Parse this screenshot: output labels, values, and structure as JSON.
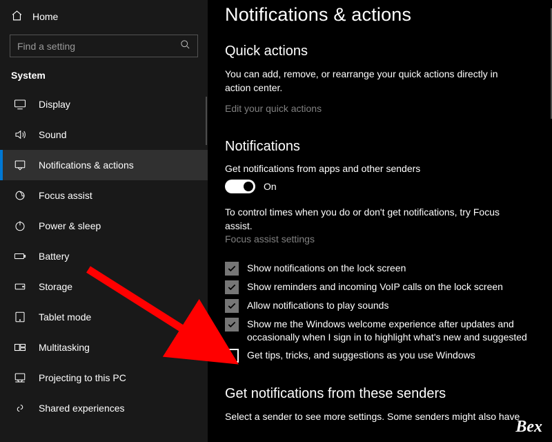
{
  "sidebar": {
    "home_label": "Home",
    "search_placeholder": "Find a setting",
    "group_label": "System",
    "items": [
      {
        "icon": "display-icon",
        "label": "Display"
      },
      {
        "icon": "sound-icon",
        "label": "Sound"
      },
      {
        "icon": "notifications-icon",
        "label": "Notifications & actions"
      },
      {
        "icon": "focus-icon",
        "label": "Focus assist"
      },
      {
        "icon": "power-icon",
        "label": "Power & sleep"
      },
      {
        "icon": "battery-icon",
        "label": "Battery"
      },
      {
        "icon": "storage-icon",
        "label": "Storage"
      },
      {
        "icon": "tablet-icon",
        "label": "Tablet mode"
      },
      {
        "icon": "multitasking-icon",
        "label": "Multitasking"
      },
      {
        "icon": "projecting-icon",
        "label": "Projecting to this PC"
      },
      {
        "icon": "shared-icon",
        "label": "Shared experiences"
      }
    ],
    "selected_index": 2
  },
  "main": {
    "title": "Notifications & actions",
    "quick_actions": {
      "heading": "Quick actions",
      "desc": "You can add, remove, or rearrange your quick actions directly in action center.",
      "link": "Edit your quick actions"
    },
    "notifications": {
      "heading": "Notifications",
      "master_label": "Get notifications from apps and other senders",
      "master_state": "On",
      "hint_a": "To control times when you do or don't get notifications, try Focus assist.",
      "hint_b": "Focus assist settings",
      "checks": [
        {
          "checked": true,
          "label": "Show notifications on the lock screen"
        },
        {
          "checked": true,
          "label": "Show reminders and incoming VoIP calls on the lock screen"
        },
        {
          "checked": true,
          "label": "Allow notifications to play sounds"
        },
        {
          "checked": true,
          "label": "Show me the Windows welcome experience after updates and occasionally when I sign in to highlight what's new and suggested"
        },
        {
          "checked": false,
          "label": "Get tips, tricks, and suggestions as you use Windows"
        }
      ]
    },
    "senders": {
      "heading": "Get notifications from these senders",
      "desc": "Select a sender to see more settings. Some senders might also have"
    }
  },
  "annotation": {
    "arrow_color": "#ff0000"
  },
  "watermark": "Bex"
}
